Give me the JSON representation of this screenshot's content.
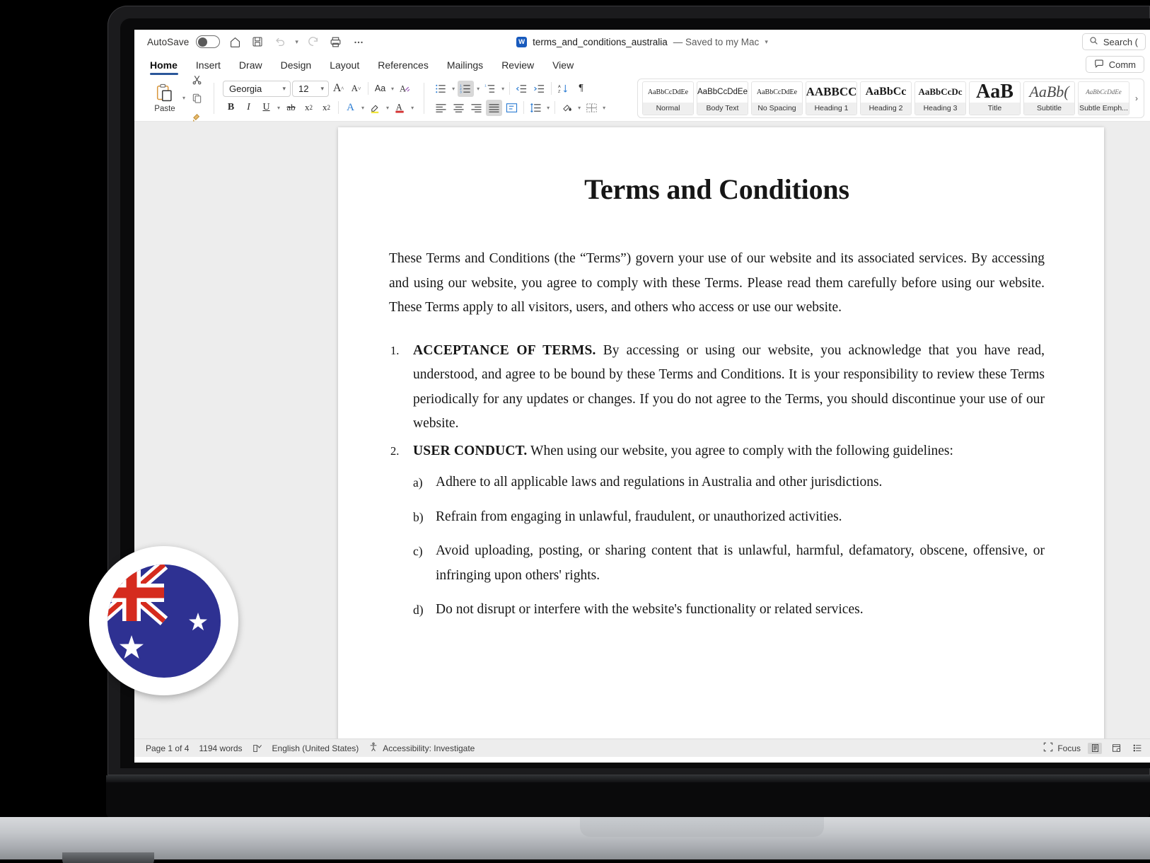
{
  "app": {
    "titlebar": {
      "autosave_label": "AutoSave",
      "autosave_state": "off",
      "home_icon": "home-icon",
      "save_icon": "save-icon",
      "undo_icon": "undo-icon",
      "redo_icon": "redo-icon",
      "print_icon": "print-icon",
      "more_icon": "ellipsis-icon",
      "doc_name": "terms_and_conditions_australia",
      "doc_saved_state": "— Saved to my Mac",
      "search_placeholder": "Search (",
      "search_icon": "search-icon"
    },
    "tabs": [
      {
        "label": "Home",
        "active": true
      },
      {
        "label": "Insert",
        "active": false
      },
      {
        "label": "Draw",
        "active": false
      },
      {
        "label": "Design",
        "active": false
      },
      {
        "label": "Layout",
        "active": false
      },
      {
        "label": "References",
        "active": false
      },
      {
        "label": "Mailings",
        "active": false
      },
      {
        "label": "Review",
        "active": false
      },
      {
        "label": "View",
        "active": false
      }
    ],
    "comments_button": "Comm",
    "ribbon": {
      "paste_label": "Paste",
      "font_name": "Georgia",
      "font_size": "12",
      "grow_font": "A",
      "shrink_font": "A",
      "change_case": "Aa",
      "clear_formatting": "clear-formatting-icon",
      "bold": "B",
      "italic": "I",
      "underline": "U",
      "strikethrough": "strikethrough-icon",
      "subscript": "x₂",
      "superscript": "x²",
      "text_effects": "A",
      "highlight": "highlight-icon",
      "font_color": "A",
      "styles": [
        {
          "preview": "AaBbCcDdEe",
          "name": "Normal",
          "style": "small-serif"
        },
        {
          "preview": "AaBbCcDdEe",
          "name": "Body Text",
          "style": "sans"
        },
        {
          "preview": "AaBbCcDdEe",
          "name": "No Spacing",
          "style": "small-serif"
        },
        {
          "preview": "AABBCC",
          "name": "Heading 1",
          "style": "bold-serif-lg"
        },
        {
          "preview": "AaBbCc",
          "name": "Heading 2",
          "style": "bold-serif"
        },
        {
          "preview": "AaBbCcDc",
          "name": "Heading 3",
          "style": "bold-serif-sm"
        },
        {
          "preview": "AaB",
          "name": "Title",
          "style": "title-serif"
        },
        {
          "preview": "AaBb(",
          "name": "Subtitle",
          "style": "italic-serif"
        },
        {
          "preview": "AaBbCcDdEe",
          "name": "Subtle Emph...",
          "style": "tiny-italic"
        }
      ],
      "gallery_more": "›"
    },
    "statusbar": {
      "page": "Page 1 of 4",
      "words": "1194 words",
      "proofing_icon": "proofing-icon",
      "language": "English (United States)",
      "accessibility_icon": "accessibility-icon",
      "accessibility": "Accessibility: Investigate",
      "focus_icon": "focus-icon",
      "focus": "Focus",
      "view_print_icon": "print-layout-icon",
      "view_web_icon": "web-layout-icon",
      "view_outline_icon": "outline-view-icon"
    }
  },
  "document": {
    "heading": "Terms and Conditions",
    "intro": "These Terms and Conditions (the “Terms”) govern your use of our website and its associated services. By accessing and using our website, you agree to comply with these Terms. Please read them carefully before using our website. These Terms apply to all visitors, users, and others who access or use our website.",
    "sections": [
      {
        "lead": "ACCEPTANCE OF TERMS.",
        "body": " By accessing or using our website, you acknowledge that you have read, understood, and agree to be bound by these Terms and Conditions. It is your responsibility to review these Terms periodically for any updates or changes. If you do not agree to the Terms, you should discontinue your use of our website.",
        "sub": []
      },
      {
        "lead": "USER CONDUCT.",
        "body": " When using our website, you agree to comply with the following guidelines:",
        "sub": [
          "Adhere to all applicable laws and regulations in Australia and other jurisdictions.",
          "Refrain from engaging in unlawful, fraudulent, or unauthorized activities.",
          "Avoid uploading, posting, or sharing content that is unlawful, harmful, defamatory, obscene, offensive, or infringing upon others' rights.",
          "Do not disrupt or interfere with the website's functionality or related services."
        ]
      }
    ]
  },
  "badge": {
    "flag_icon": "australia-flag-icon",
    "flag_colors": {
      "navy": "#2E3192",
      "red": "#D52B1E",
      "white": "#FFFFFF"
    }
  },
  "colors": {
    "word_accent": "#2b579a",
    "word_blue": "#185ABD",
    "canvas": "#ededed",
    "statusbar": "#ededed"
  }
}
